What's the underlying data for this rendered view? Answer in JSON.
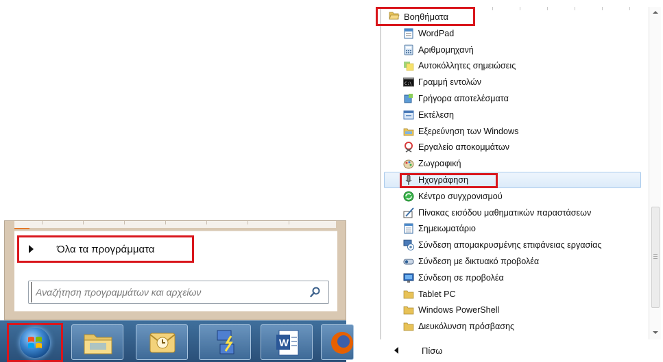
{
  "start_menu": {
    "all_programs_label": "Όλα τα προγράμματα",
    "search_placeholder": "Αναζήτηση προγραμμάτων και αρχείων"
  },
  "taskbar": {
    "buttons": [
      {
        "name": "windows-explorer",
        "icon": "folder-icon"
      },
      {
        "name": "outlook",
        "icon": "mail-clock-icon"
      },
      {
        "name": "network-connect",
        "icon": "network-plug-icon"
      },
      {
        "name": "word",
        "icon": "word-document-icon"
      },
      {
        "name": "firefox",
        "icon": "firefox-icon"
      }
    ]
  },
  "programs_panel": {
    "folder_label": "Βοηθήματα",
    "items": [
      {
        "label": "WordPad",
        "icon": "wordpad-icon"
      },
      {
        "label": "Αριθμομηχανή",
        "icon": "calculator-icon"
      },
      {
        "label": "Αυτοκόλλητες σημειώσεις",
        "icon": "sticky-notes-icon"
      },
      {
        "label": "Γραμμή εντολών",
        "icon": "command-prompt-icon"
      },
      {
        "label": "Γρήγορα αποτελέσματα",
        "icon": "getting-started-icon"
      },
      {
        "label": "Εκτέλεση",
        "icon": "run-icon"
      },
      {
        "label": "Εξερεύνηση των Windows",
        "icon": "explorer-folder-icon"
      },
      {
        "label": "Εργαλείο αποκομμάτων",
        "icon": "snipping-tool-icon"
      },
      {
        "label": "Ζωγραφική",
        "icon": "paint-icon"
      },
      {
        "label": "Ηχογράφηση",
        "icon": "microphone-icon"
      },
      {
        "label": "Κέντρο συγχρονισμού",
        "icon": "sync-center-icon"
      },
      {
        "label": "Πίνακας εισόδου μαθηματικών παραστάσεων",
        "icon": "math-input-icon"
      },
      {
        "label": "Σημειωματάριο",
        "icon": "notepad-icon"
      },
      {
        "label": "Σύνδεση απομακρυσμένης επιφάνειας εργασίας",
        "icon": "remote-desktop-icon"
      },
      {
        "label": "Σύνδεση με δικτυακό προβολέα",
        "icon": "network-projector-icon"
      },
      {
        "label": "Σύνδεση σε προβολέα",
        "icon": "projector-icon"
      },
      {
        "label": "Tablet PC",
        "icon": "folder-icon"
      },
      {
        "label": "Windows PowerShell",
        "icon": "folder-icon"
      },
      {
        "label": "Διευκόλυνση πρόσβασης",
        "icon": "folder-icon"
      }
    ],
    "selected_item": "Ηχογράφηση",
    "back_label": "Πίσω"
  },
  "colors": {
    "highlight_border": "#d9161c",
    "taskbar": "#2f5a86",
    "selection": "#dcebfa"
  }
}
